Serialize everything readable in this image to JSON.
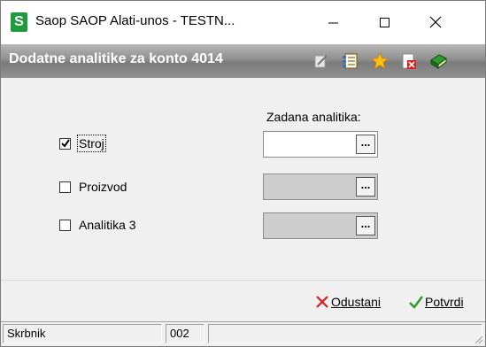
{
  "window": {
    "title": "Saop SAOP Alati-unos - TESTN...",
    "app_icon_letter": "S",
    "minimize_icon": "minimize-icon",
    "maximize_icon": "maximize-icon",
    "close_icon": "close-icon"
  },
  "header": {
    "title": "Dodatne analitike za konto 4014",
    "toolbar_icons": [
      "edit-icon",
      "list-icon",
      "favorite-star-icon",
      "delete-document-icon",
      "exit-book-icon"
    ]
  },
  "form": {
    "section_label": "Zadana analitika:",
    "rows": [
      {
        "label": "Stroj",
        "checked": true,
        "value": "",
        "enabled": true
      },
      {
        "label": "Proizvod",
        "checked": false,
        "value": "",
        "enabled": false
      },
      {
        "label": "Analitika 3",
        "checked": false,
        "value": "",
        "enabled": false
      }
    ],
    "lookup_button_label": "..."
  },
  "actions": {
    "cancel_label": "Odustani",
    "confirm_label": "Potvrdi"
  },
  "statusbar": {
    "field1": "Skrbnik",
    "field2": "002",
    "field3": ""
  },
  "colors": {
    "app_icon": "#1f9a3c",
    "header_band": "#8f8f8f",
    "cancel_red": "#d81e1e",
    "confirm_green": "#2e9a2e"
  }
}
